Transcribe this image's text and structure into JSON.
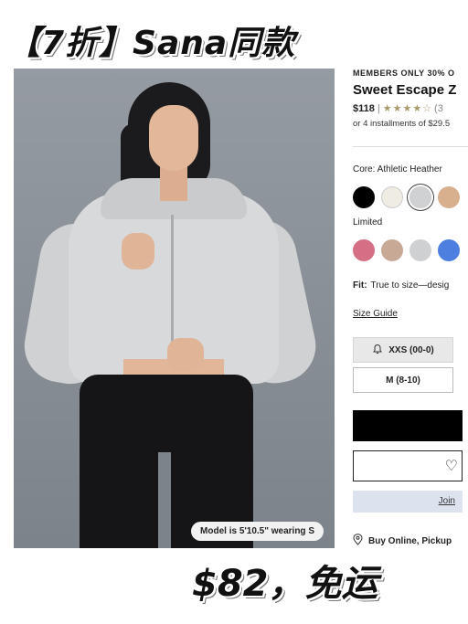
{
  "banner": {
    "text": "【7折】Sana同款"
  },
  "photo": {
    "model_caption": "Model is 5'10.5\" wearing S"
  },
  "product": {
    "promo": "MEMBERS ONLY 30% O",
    "name": "Sweet Escape Z",
    "price": "$118",
    "separator": "|",
    "stars": "★★★★☆",
    "rating": 4,
    "review_count": "(3",
    "installments": "or 4 installments of $29.5"
  },
  "colors": {
    "core_label": "Core: Athletic Heather",
    "core": [
      "#000000",
      "#efece3",
      "#cfd1d3",
      "#d8b08e"
    ],
    "limited_label": "Limited",
    "limited": [
      "#d46f86",
      "#c8a996",
      "#cfd0d1",
      "#4d7fe0"
    ]
  },
  "fit": {
    "label": "Fit:",
    "text": "True to size—desig"
  },
  "size_guide": "Size Guide",
  "sizes": [
    {
      "label": "XXS (00-0)",
      "icon": "bell-icon"
    },
    {
      "label": "M (8-10)"
    }
  ],
  "join_text": "Join",
  "buy_online": "Buy Online, Pickup",
  "big_price": "$82，免运"
}
